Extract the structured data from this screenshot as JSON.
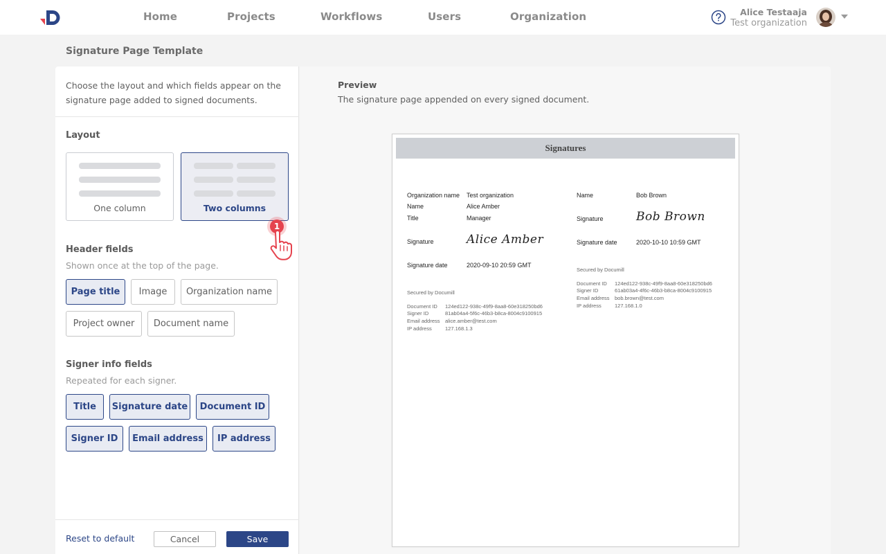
{
  "nav": {
    "items": [
      "Home",
      "Projects",
      "Workflows",
      "Users",
      "Organization"
    ]
  },
  "user": {
    "name": "Alice Testaaja",
    "organization": "Test organization"
  },
  "icons": {
    "help": "question-circle-icon",
    "avatar": "user-avatar",
    "dropdown": "chevron-down-icon",
    "pointer": "hand-pointer-icon"
  },
  "colors": {
    "primary": "#2c4687",
    "logo_red": "#e5434e",
    "marker": "#e5434e"
  },
  "page": {
    "title": "Signature Page Template"
  },
  "left": {
    "intro": "Choose the layout and which fields appear on the signature page added to signed documents.",
    "layout": {
      "title": "Layout",
      "options": [
        {
          "label": "One column",
          "selected": false
        },
        {
          "label": "Two columns",
          "selected": true
        }
      ]
    },
    "header_fields": {
      "title": "Header fields",
      "subtitle": "Shown once at the top of the page.",
      "chips": [
        {
          "label": "Page title",
          "on": true
        },
        {
          "label": "Image",
          "on": false
        },
        {
          "label": "Organization name",
          "on": false
        },
        {
          "label": "Project owner",
          "on": false
        },
        {
          "label": "Document name",
          "on": false
        }
      ]
    },
    "signer_fields": {
      "title": "Signer info fields",
      "subtitle": "Repeated for each signer.",
      "chips": [
        {
          "label": "Title",
          "on": true
        },
        {
          "label": "Signature date",
          "on": true
        },
        {
          "label": "Document ID",
          "on": true
        },
        {
          "label": "Signer ID",
          "on": true
        },
        {
          "label": "Email address",
          "on": true
        },
        {
          "label": "IP address",
          "on": true
        }
      ]
    },
    "footer": {
      "reset": "Reset to default",
      "cancel": "Cancel",
      "save": "Save"
    }
  },
  "preview": {
    "title": "Preview",
    "subtitle": "The signature page appended on every signed document.",
    "doc": {
      "header": "Signatures",
      "signers": [
        {
          "org_label": "Organization name",
          "org_value": "Test organization",
          "name_label": "Name",
          "name_value": "Alice Amber",
          "title_label": "Title",
          "title_value": "Manager",
          "sig_label": "Signature",
          "sig_value": "Alice Amber",
          "date_label": "Signature date",
          "date_value": "2020-09-10 20:59 GMT",
          "secured": "Secured by Documill",
          "doc_id_label": "Document ID",
          "doc_id": "124ed122-938c-49f9-8aa8-60e318250bd6",
          "signer_id_label": "Signer ID",
          "signer_id": "81ab04a4-5f6c-46b3-b8ca-8004c9100915",
          "email_label": "Email address",
          "email": "alice.amber@test.com",
          "ip_label": "IP address",
          "ip": "127.168.1.3"
        },
        {
          "name_label": "Name",
          "name_value": "Bob Brown",
          "sig_label": "Signature",
          "sig_value": "Bob Brown",
          "date_label": "Signature date",
          "date_value": "2020-10-10 10:59 GMT",
          "secured": "Secured by Documill",
          "doc_id_label": "Document ID",
          "doc_id": "124ed122-938c-49f9-8aa8-60e318250bd6",
          "signer_id_label": "Signer ID",
          "signer_id": "61ab03a4-4f6c-46b3-b8ca-8004c9100915",
          "email_label": "Email address",
          "email": "bob.brown@test.com",
          "ip_label": "IP address",
          "ip": "127.168.1.0"
        }
      ]
    }
  },
  "annotation": {
    "step": "1"
  }
}
